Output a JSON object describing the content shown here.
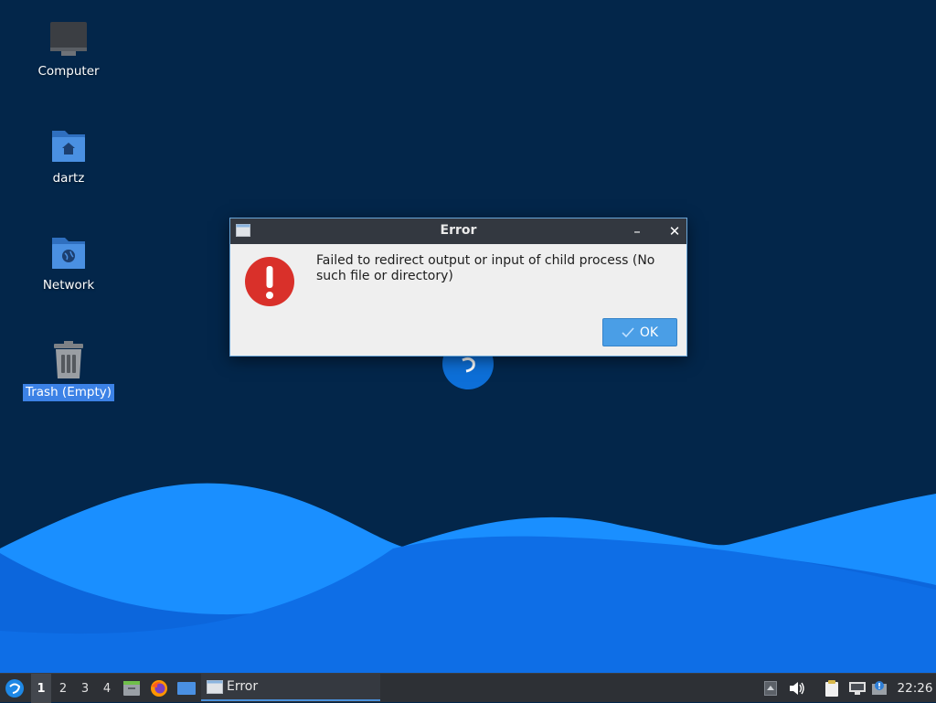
{
  "colors": {
    "desktop_bg": "#03264a",
    "wave_light": "#1a8fff",
    "wave_dark": "#0a5fd6",
    "dialog_titlebar": "#333840",
    "error_red": "#d9302a",
    "ok_button": "#4a9ee6",
    "taskbar_bg": "#2d3035"
  },
  "desktop": {
    "icons": [
      {
        "label": "Computer",
        "icon": "computer-icon"
      },
      {
        "label": "dartz",
        "icon": "home-folder-icon"
      },
      {
        "label": "Network",
        "icon": "network-folder-icon"
      },
      {
        "label": "Trash (Empty)",
        "icon": "trash-icon",
        "selected": true
      }
    ]
  },
  "dialog": {
    "title": "Error",
    "minimize_glyph": "–",
    "close_glyph": "✕",
    "message": "Failed to redirect output or input of child process (No such file or directory)",
    "icon": "error-icon",
    "ok_label": "OK",
    "ok_icon": "checkmark-icon"
  },
  "taskbar": {
    "menu_icon": "lubuntu-menu-icon",
    "workspaces": [
      "1",
      "2",
      "3",
      "4"
    ],
    "active_workspace": "1",
    "launchers": [
      "file-manager-icon",
      "firefox-icon",
      "show-desktop-icon"
    ],
    "task": {
      "label": "Error",
      "icon": "window-icon"
    },
    "tray": [
      "tray-arrow-icon",
      "volume-icon",
      "clipboard-icon",
      "network-status-icon",
      "update-notifier-icon"
    ],
    "clock": "22:26"
  }
}
